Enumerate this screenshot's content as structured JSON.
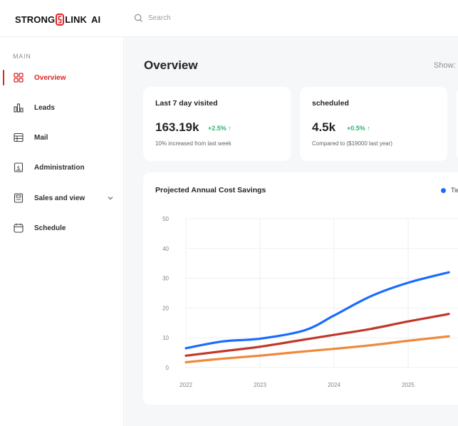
{
  "brand": {
    "name_left": "STRONG",
    "name_right": "LINK",
    "name_suffix": "AI",
    "accent": "#e02424"
  },
  "search": {
    "placeholder": "Search",
    "icon": "search-icon"
  },
  "sidebar": {
    "section": "MAIN",
    "items": [
      {
        "label": "Overview",
        "icon": "grid-icon",
        "active": true
      },
      {
        "label": "Leads",
        "icon": "bar-chart-icon"
      },
      {
        "label": "Mail",
        "icon": "table-icon"
      },
      {
        "label": "Administration",
        "icon": "dollar-doc-icon"
      },
      {
        "label": "Sales and view",
        "icon": "register-icon",
        "has_submenu": true
      },
      {
        "label": "Schedule",
        "icon": "calendar-icon"
      }
    ]
  },
  "main": {
    "title": "Overview",
    "show_label": "Show:",
    "stats": [
      {
        "title": "Last 7 day visited",
        "value": "163.19k",
        "change": "+2.5% ↑",
        "note": "10% increased from last week"
      },
      {
        "title": "scheduled",
        "value": "4.5k",
        "change": "+0.5% ↑",
        "note": "Compared to ($19000 last year)"
      }
    ]
  },
  "chart_data": {
    "type": "line",
    "title": "Projected Annual Cost Savings",
    "xlabel": "",
    "ylabel": "",
    "x_ticks": [
      "2022",
      "2023",
      "2024",
      "2025"
    ],
    "y_ticks": [
      0,
      10,
      20,
      30,
      40,
      50
    ],
    "xlim": [
      2022,
      2026
    ],
    "ylim": [
      0,
      50
    ],
    "grid": true,
    "legend": {
      "label": "Tie",
      "placement": "top-right"
    },
    "series": [
      {
        "color": "#1a6bff",
        "points": [
          [
            2022,
            6.5
          ],
          [
            2022.5,
            8.8
          ],
          [
            2023,
            9.7
          ],
          [
            2023.6,
            12.5
          ],
          [
            2024,
            17.5
          ],
          [
            2024.5,
            24
          ],
          [
            2025,
            28.5
          ],
          [
            2025.55,
            32
          ]
        ]
      },
      {
        "color": "#c0392b",
        "points": [
          [
            2022,
            4
          ],
          [
            2022.5,
            5.5
          ],
          [
            2023,
            7
          ],
          [
            2023.5,
            9
          ],
          [
            2024,
            11
          ],
          [
            2024.5,
            13
          ],
          [
            2025,
            15.5
          ],
          [
            2025.55,
            18
          ]
        ]
      },
      {
        "color": "#ef8a3c",
        "points": [
          [
            2022,
            1.8
          ],
          [
            2022.5,
            3
          ],
          [
            2023,
            4
          ],
          [
            2023.5,
            5.2
          ],
          [
            2024,
            6.3
          ],
          [
            2024.5,
            7.5
          ],
          [
            2025,
            9
          ],
          [
            2025.55,
            10.5
          ]
        ]
      }
    ]
  }
}
